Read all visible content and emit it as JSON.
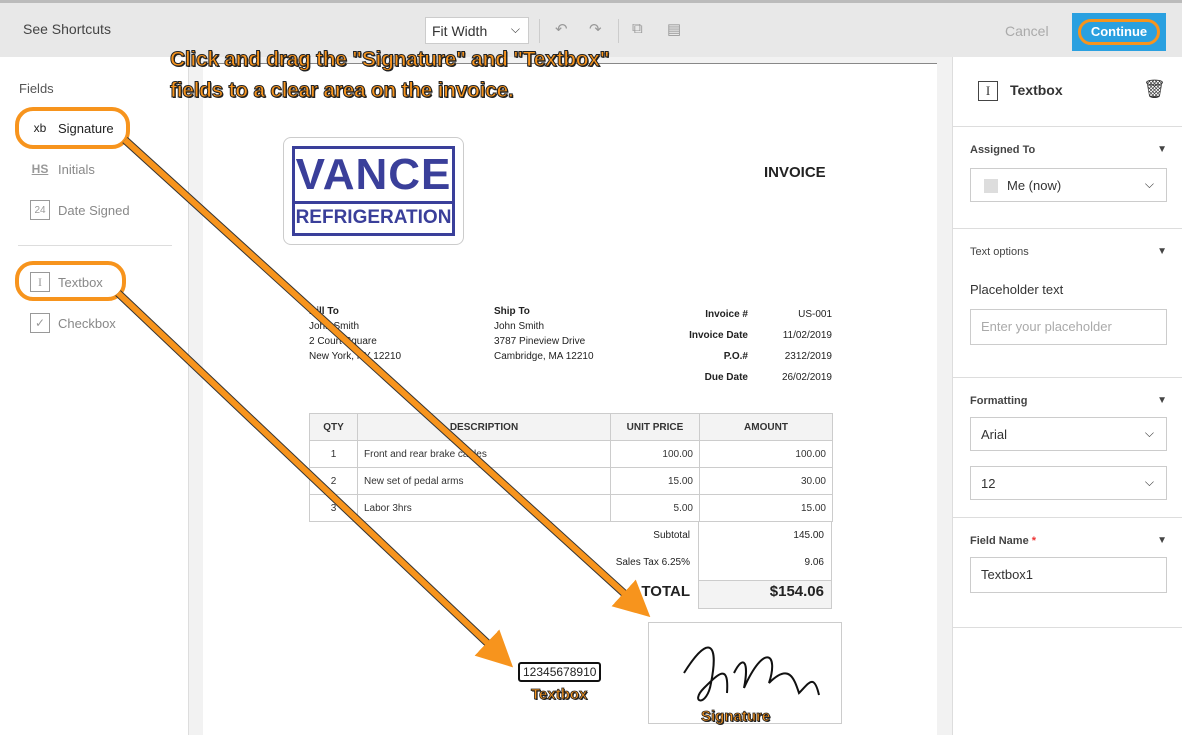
{
  "toolbar": {
    "shortcuts": "See Shortcuts",
    "zoom": "Fit Width",
    "cancel": "Cancel",
    "continue": "Continue"
  },
  "fields": {
    "title": "Fields",
    "items": [
      {
        "label": "Signature",
        "icon": "xb"
      },
      {
        "label": "Initials",
        "icon": "HS"
      },
      {
        "label": "Date Signed",
        "icon": "24"
      },
      {
        "label": "Textbox",
        "icon": "I"
      },
      {
        "label": "Checkbox",
        "icon": "✓"
      }
    ]
  },
  "instruction": "Click and drag the \"Signature\" and \"Textbox\" fields to a clear area on the invoice.",
  "invoice": {
    "logo_line1": "VANCE",
    "logo_line2": "REFRIGERATION",
    "title": "INVOICE",
    "bill_to": {
      "label": "Bill To",
      "name": "John Smith",
      "addr1": "2 Court Square",
      "addr2": "New York, NY 12210"
    },
    "ship_to": {
      "label": "Ship To",
      "name": "John Smith",
      "addr1": "3787 Pineview Drive",
      "addr2": "Cambridge, MA 12210"
    },
    "meta": [
      {
        "k": "Invoice #",
        "v": "US-001"
      },
      {
        "k": "Invoice Date",
        "v": "11/02/2019"
      },
      {
        "k": "P.O.#",
        "v": "2312/2019"
      },
      {
        "k": "Due Date",
        "v": "26/02/2019"
      }
    ],
    "headers": [
      "QTY",
      "DESCRIPTION",
      "UNIT PRICE",
      "AMOUNT"
    ],
    "rows": [
      [
        "1",
        "Front and rear brake cables",
        "100.00",
        "100.00"
      ],
      [
        "2",
        "New set of pedal arms",
        "15.00",
        "30.00"
      ],
      [
        "3",
        "Labor 3hrs",
        "5.00",
        "15.00"
      ]
    ],
    "subtotal_label": "Subtotal",
    "subtotal": "145.00",
    "tax_label": "Sales Tax 6.25%",
    "tax": "9.06",
    "total_label": "TOTAL",
    "total": "$154.06"
  },
  "placed": {
    "textbox_value": "12345678910",
    "textbox_label": "Textbox",
    "signature_label": "Signature"
  },
  "panel": {
    "title": "Textbox",
    "assigned_label": "Assigned To",
    "assigned_value": "Me (now)",
    "text_options": "Text options",
    "placeholder_label": "Placeholder text",
    "placeholder_hint": "Enter your placeholder",
    "formatting": "Formatting",
    "font": "Arial",
    "size": "12",
    "field_name_label": "Field Name",
    "required": "*",
    "field_name": "Textbox1"
  },
  "colors": {
    "accent": "#2aa0e0",
    "annotation": "#f7941d"
  }
}
